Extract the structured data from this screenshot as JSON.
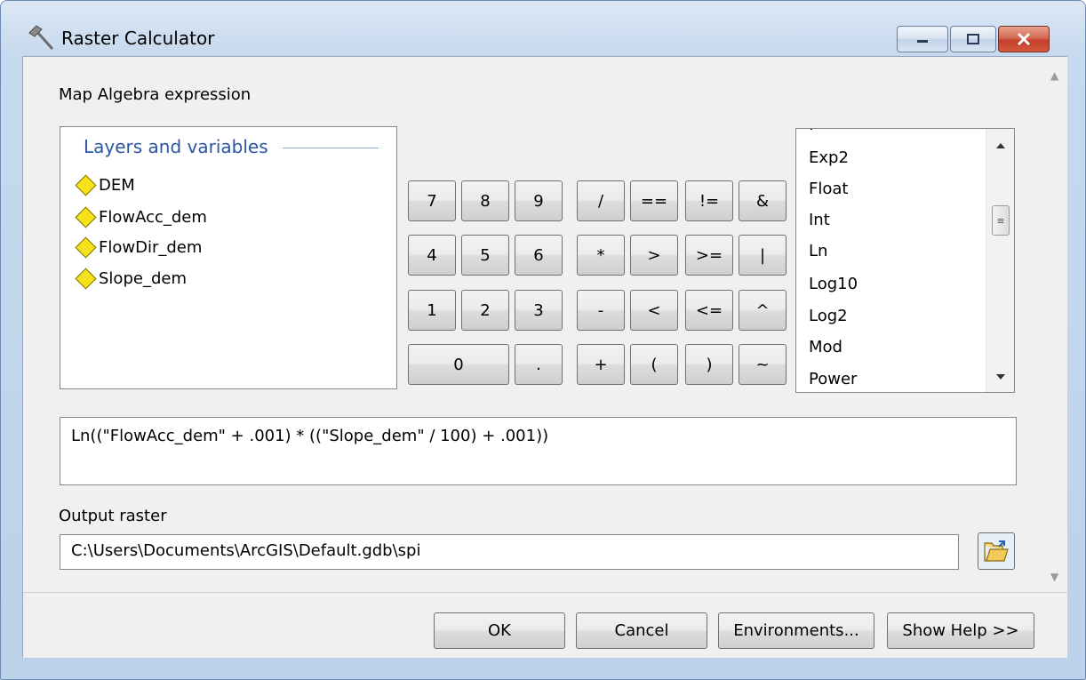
{
  "window": {
    "title": "Raster Calculator"
  },
  "expression_section": {
    "label": "Map Algebra expression"
  },
  "layers": {
    "header": "Layers and variables",
    "items": [
      "DEM",
      "FlowAcc_dem",
      "FlowDir_dem",
      "Slope_dem"
    ]
  },
  "keypad": {
    "rows": [
      [
        "7",
        "8",
        "9",
        "/",
        "==",
        "!=",
        "&"
      ],
      [
        "4",
        "5",
        "6",
        "*",
        ">",
        ">=",
        "|"
      ],
      [
        "1",
        "2",
        "3",
        "-",
        "<",
        "<=",
        "^"
      ],
      [
        "0",
        ".",
        "+",
        "(",
        ")",
        "~"
      ]
    ]
  },
  "functions": {
    "items": [
      "Exp2",
      "Float",
      "Int",
      "Ln",
      "Log10",
      "Log2",
      "Mod",
      "Power"
    ]
  },
  "expression": {
    "value": "Ln((\"FlowAcc_dem\" + .001) * ((\"Slope_dem\" / 100) + .001))"
  },
  "output": {
    "label": "Output raster",
    "value": "C:\\Users\\Documents\\ArcGIS\\Default.gdb\\spi"
  },
  "buttons": {
    "ok": "OK",
    "cancel": "Cancel",
    "environments": "Environments...",
    "help": "Show Help >>"
  },
  "icons": {
    "app": "hammer-icon",
    "browse": "open-folder-icon"
  }
}
